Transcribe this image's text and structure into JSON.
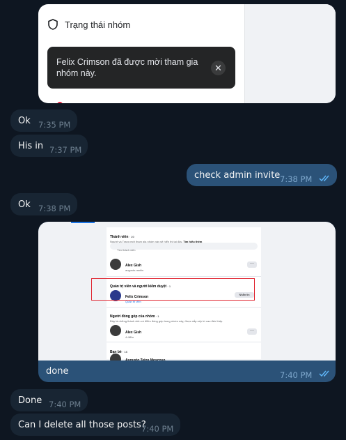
{
  "messages": {
    "m1": {
      "text": "Ok",
      "time": "7:35 PM"
    },
    "m2": {
      "text": "His in",
      "time": "7:37 PM"
    },
    "m3": {
      "text": "check admin invite",
      "time": "7:38 PM"
    },
    "m4": {
      "text": "Ok",
      "time": "7:38 PM"
    },
    "m5": {
      "caption": "done",
      "time": "7:40 PM"
    },
    "m6": {
      "text": "Done",
      "time": "7:40 PM"
    },
    "m7": {
      "text": "Can I delete all those posts?",
      "time": "7:40 PM"
    }
  },
  "shot1": {
    "menu_item": "Trạng thái nhóm",
    "toast": "Felix Crimson đã được mời tham gia nhóm này.",
    "close": "✕"
  },
  "shot2": {
    "members_title": "Thành viên",
    "members_count": "· 20",
    "members_desc": "Người và Trang mới tham gia nhóm này sẽ hiển thị tại đây.",
    "learn_more": "Tìm hiểu thêm",
    "search_placeholder": "Tìm thành viên",
    "member1_name": "Alex Gish",
    "member1_sub": "augusto.rankin",
    "admins_title": "Quản trị viên và người kiểm duyệt",
    "admins_count": "· 1",
    "admin1_name": "Felix Crimson",
    "admin1_role": "Quản trị viên",
    "message_btn": "Nhắn tin",
    "contributors_title": "Người đóng góp của nhóm",
    "contributors_count": "· 1",
    "contributors_desc": "Đây là những thành viên có điểm đóng góp trong nhóm này, được sắp xếp từ cao đến thấp.",
    "contrib1_name": "Alex Gish",
    "contrib1_points": "4 điểm",
    "friends_title": "Bạn bè",
    "friends_count": "· 16",
    "friend1_name": "Augusto Teixo Moscoso",
    "dots": "···"
  },
  "colors": {
    "background": "#0e1621",
    "incoming_bubble": "#182533",
    "outgoing_bubble": "#2b5278",
    "read_ticks": "#5eb5f7"
  }
}
